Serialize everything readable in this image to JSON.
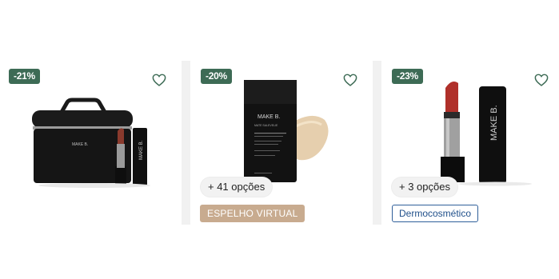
{
  "colors": {
    "badge_bg": "#3d6b55",
    "heart_stroke": "#3d6b55",
    "espelho_bg": "#c8ab8f",
    "dermo_border": "#2f5f9a"
  },
  "products": [
    {
      "discount": "-21%",
      "image_desc": "necessaire-kit-icon",
      "brand_mark": "MAKE B."
    },
    {
      "discount": "-20%",
      "image_desc": "foundation-bottle-icon",
      "brand_mark": "MAKE B.",
      "sub_mark": "MATE SALEVELIE",
      "options": "+ 41 opções",
      "tag": "ESPELHO VIRTUAL"
    },
    {
      "discount": "-23%",
      "image_desc": "lipstick-icon",
      "brand_mark": "MAKE B.",
      "options": "+ 3 opções",
      "tag": "Dermocosmético"
    }
  ]
}
